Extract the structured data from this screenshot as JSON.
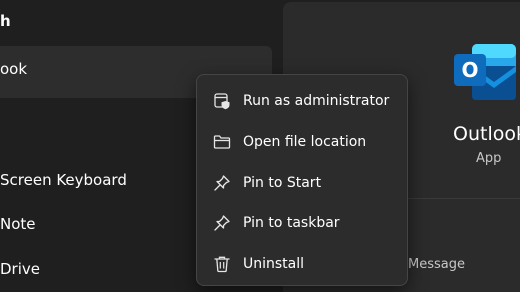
{
  "results": {
    "header": "h",
    "best_match": "ook",
    "apps": [
      "Screen Keyboard",
      "Note",
      "Drive"
    ]
  },
  "detail": {
    "app_name": "Outlook",
    "app_type": "App",
    "action_partial": "Message",
    "logo_letter": "O",
    "brand_colors": {
      "primary": "#0f6cbd",
      "light": "#28a8ea",
      "dark": "#0a4f92"
    }
  },
  "context_menu": {
    "items": [
      {
        "label": "Run as administrator",
        "icon": "shield-app-icon"
      },
      {
        "label": "Open file location",
        "icon": "folder-icon"
      },
      {
        "label": "Pin to Start",
        "icon": "pin-icon"
      },
      {
        "label": "Pin to taskbar",
        "icon": "pin-icon"
      },
      {
        "label": "Uninstall",
        "icon": "trash-icon"
      }
    ]
  }
}
